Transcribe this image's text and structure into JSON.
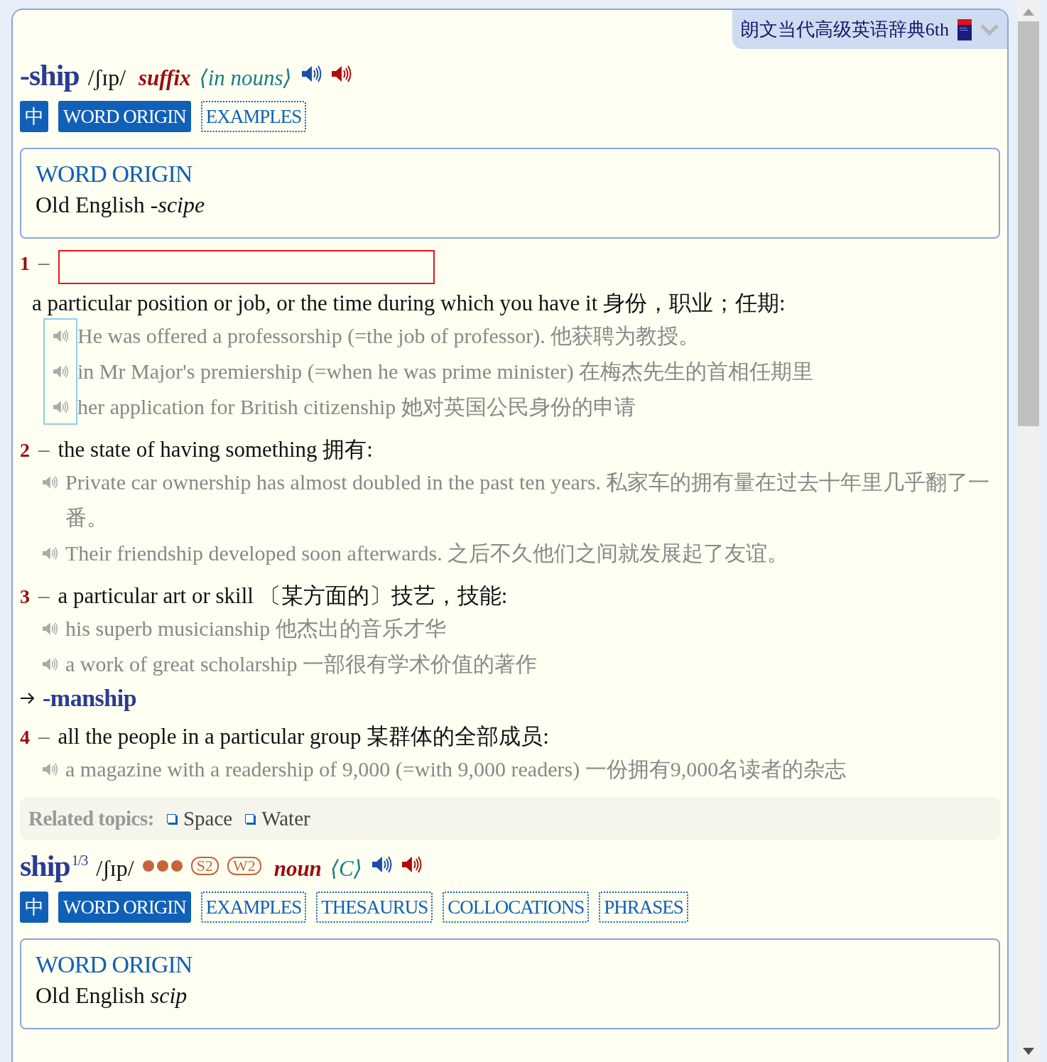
{
  "dictionary_tab": {
    "name": "朗文当代高级英语辞典6th"
  },
  "entries": [
    {
      "headword": "-ship",
      "pronunciation": "/ʃɪp/",
      "part_of_speech": "suffix",
      "grammar": "⟨in nouns⟩",
      "tabs": [
        {
          "label": "中",
          "selected": true
        },
        {
          "label": "WORD ORIGIN",
          "selected": true
        },
        {
          "label": "EXAMPLES",
          "selected": false
        }
      ],
      "word_origin": {
        "title": "WORD ORIGIN",
        "text": "Old English *-scipe*"
      },
      "senses": [
        {
          "number": "1",
          "separator": "–",
          "highlighted": true,
          "definition": "a particular position or job, or the time during which you have it",
          "translation": "身份，职业；任期:",
          "examples": [
            "He was offered a professorship (=the job of professor). 他获聘为教授。",
            "in Mr Major's premiership (=when he was prime minister)  在梅杰先生的首相任期里",
            "her application for British citizenship 她对英国公民身份的申请"
          ]
        },
        {
          "number": "2",
          "separator": "–",
          "highlighted": false,
          "definition": "the state of having something",
          "translation": "拥有:",
          "examples": [
            "Private car ownership has almost doubled in the past ten years. 私家车的拥有量在过去十年里几乎翻了一番。",
            "Their friendship developed soon afterwards. 之后不久他们之间就发展起了友谊。"
          ]
        },
        {
          "number": "3",
          "separator": "–",
          "highlighted": false,
          "definition": "a particular art or skill",
          "translation": "〔某方面的〕技艺，技能:",
          "examples": [
            "his superb musicianship 他杰出的音乐才华",
            "a work of great scholarship 一部很有学术价值的著作"
          ],
          "see_also": "-manship"
        },
        {
          "number": "4",
          "separator": "–",
          "highlighted": false,
          "definition": "all the people in a particular group",
          "translation": "某群体的全部成员:",
          "examples": [
            "a magazine with a readership of 9,000 (=with 9,000 readers)  一份拥有9,000名读者的杂志"
          ]
        }
      ],
      "related_topics": {
        "label": "Related topics:",
        "topics": [
          "Space",
          "Water"
        ]
      }
    },
    {
      "headword": "ship",
      "homograph": "1/3",
      "pronunciation": "/ʃɪp/",
      "stars": 3,
      "badges": [
        "S2",
        "W2"
      ],
      "part_of_speech": "noun",
      "grammar": "⟨C⟩",
      "tabs": [
        {
          "label": "中",
          "selected": true
        },
        {
          "label": "WORD ORIGIN",
          "selected": true
        },
        {
          "label": "EXAMPLES",
          "selected": false
        },
        {
          "label": "THESAURUS",
          "selected": false
        },
        {
          "label": "COLLOCATIONS",
          "selected": false
        },
        {
          "label": "PHRASES",
          "selected": false
        }
      ],
      "word_origin": {
        "title": "WORD ORIGIN",
        "text": "Old English *scip*"
      }
    }
  ]
}
